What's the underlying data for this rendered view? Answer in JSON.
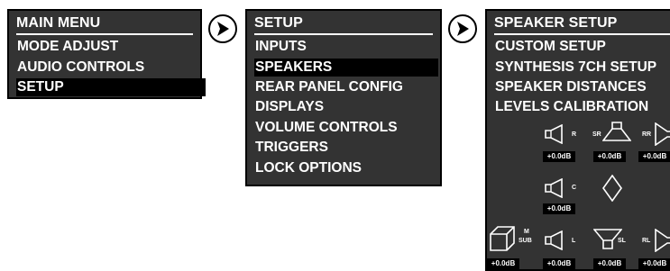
{
  "main_menu": {
    "title": "MAIN MENU",
    "items": [
      {
        "label": "MODE ADJUST",
        "selected": false
      },
      {
        "label": "AUDIO CONTROLS",
        "selected": false
      },
      {
        "label": "SETUP",
        "selected": true
      }
    ]
  },
  "setup_menu": {
    "title": "SETUP",
    "items": [
      {
        "label": "INPUTS",
        "selected": false
      },
      {
        "label": "SPEAKERS",
        "selected": true
      },
      {
        "label": "REAR PANEL CONFIG",
        "selected": false
      },
      {
        "label": "DISPLAYS",
        "selected": false
      },
      {
        "label": "VOLUME CONTROLS",
        "selected": false
      },
      {
        "label": "TRIGGERS",
        "selected": false
      },
      {
        "label": "LOCK OPTIONS",
        "selected": false
      }
    ]
  },
  "speaker_setup": {
    "title": "SPEAKER SETUP",
    "items": [
      {
        "label": "CUSTOM SETUP"
      },
      {
        "label": "SYNTHESIS 7CH SETUP"
      },
      {
        "label": "SPEAKER DISTANCES"
      },
      {
        "label": "LEVELS CALIBRATION"
      }
    ],
    "speakers": {
      "R": {
        "label": "R",
        "level": "+0.0dB"
      },
      "SR": {
        "label": "SR",
        "level": "+0.0dB"
      },
      "RR": {
        "label": "RR",
        "level": "+0.0dB"
      },
      "C": {
        "label": "C",
        "level": "+0.0dB"
      },
      "SUB": {
        "label_top": "M",
        "label_bottom": "SUB",
        "level": "+0.0dB"
      },
      "L": {
        "label": "L",
        "level": "+0.0dB"
      },
      "SL": {
        "label": "SL",
        "level": "+0.0dB"
      },
      "RL": {
        "label": "RL",
        "level": "+0.0dB"
      }
    }
  },
  "colors": {
    "panel_bg": "#333333",
    "selected_bg": "#000000",
    "text": "#ffffff"
  }
}
